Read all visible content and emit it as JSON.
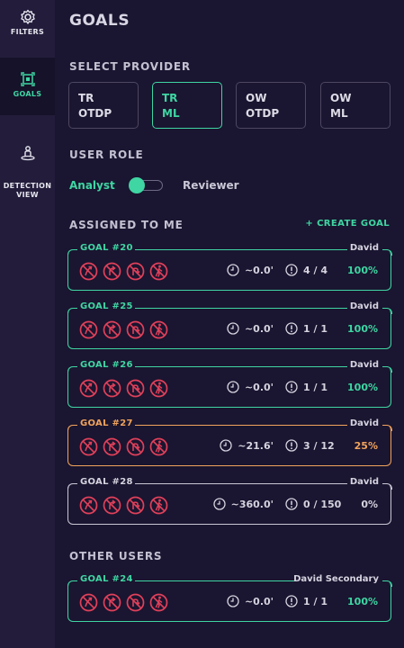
{
  "sidebar": {
    "items": [
      {
        "label": "FILTERS",
        "icon": "gear-icon"
      },
      {
        "label": "GOALS",
        "icon": "target-frame-icon",
        "active": true
      },
      {
        "label": "DETECTION\nVIEW",
        "icon": "person-detection-icon"
      }
    ]
  },
  "page": {
    "title": "GOALS"
  },
  "provider": {
    "label": "SELECT PROVIDER",
    "options": [
      {
        "line1": "TR",
        "line2": "OTDP",
        "selected": false
      },
      {
        "line1": "TR",
        "line2": "ML",
        "selected": true
      },
      {
        "line1": "OW",
        "line2": "OTDP",
        "selected": false
      },
      {
        "line1": "OW",
        "line2": "ML",
        "selected": false
      }
    ]
  },
  "role": {
    "label": "USER ROLE",
    "left": "Analyst",
    "right": "Reviewer",
    "value": "Analyst"
  },
  "assigned": {
    "label": "ASSIGNED TO ME",
    "create_label": "+ CREATE GOAL",
    "goals": [
      {
        "name": "GOAL #20",
        "owner": "David",
        "time": "~0.0'",
        "count": "4 / 4",
        "pct": "100%",
        "status": "green"
      },
      {
        "name": "GOAL #25",
        "owner": "David",
        "time": "~0.0'",
        "count": "1 / 1",
        "pct": "100%",
        "status": "green"
      },
      {
        "name": "GOAL #26",
        "owner": "David",
        "time": "~0.0'",
        "count": "1 / 1",
        "pct": "100%",
        "status": "green"
      },
      {
        "name": "GOAL #27",
        "owner": "David",
        "time": "~21.6'",
        "count": "3 / 12",
        "pct": "25%",
        "status": "orange"
      },
      {
        "name": "GOAL #28",
        "owner": "David",
        "time": "~360.0'",
        "count": "0 / 150",
        "pct": "0%",
        "status": "gray"
      }
    ]
  },
  "other": {
    "label": "OTHER USERS",
    "goals": [
      {
        "name": "GOAL #24",
        "owner": "David Secondary",
        "time": "~0.0'",
        "count": "1 / 1",
        "pct": "100%",
        "status": "green"
      }
    ]
  },
  "colors": {
    "accent": "#3fd6a3",
    "warning": "#f0a35c",
    "icon_red": "#e0405a",
    "background": "#1a1530",
    "sidebar": "#231d3b"
  },
  "card_icons": [
    "no-straight-icon",
    "no-right-turn-icon",
    "no-u-turn-icon",
    "no-pedestrian-icon"
  ]
}
